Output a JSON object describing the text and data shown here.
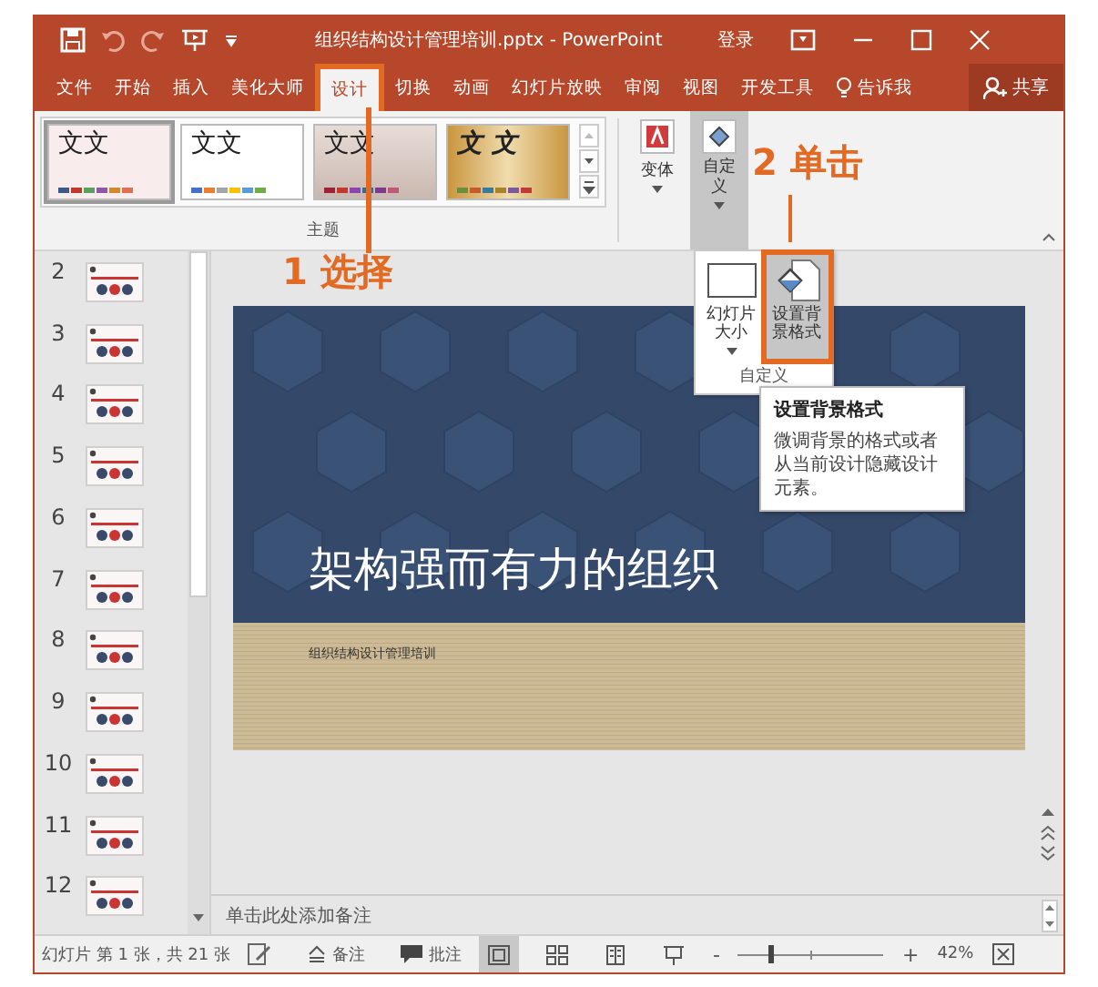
{
  "title_bar": {
    "title": "组织结构设计管理培训.pptx  -  PowerPoint",
    "sign_in": "登录"
  },
  "tabs": [
    {
      "label": "文件",
      "selected": false
    },
    {
      "label": "开始",
      "selected": false
    },
    {
      "label": "插入",
      "selected": false
    },
    {
      "label": "美化大师",
      "selected": false
    },
    {
      "label": "设计",
      "selected": true
    },
    {
      "label": "切换",
      "selected": false
    },
    {
      "label": "动画",
      "selected": false
    },
    {
      "label": "幻灯片放映",
      "selected": false
    },
    {
      "label": "审阅",
      "selected": false
    },
    {
      "label": "视图",
      "selected": false
    },
    {
      "label": "开发工具",
      "selected": false
    }
  ],
  "tell_me": "告诉我",
  "share": "共享",
  "ribbon": {
    "themes": [
      {
        "label": "文文",
        "kind": "pink",
        "selected": true
      },
      {
        "label": "文文",
        "kind": "white",
        "selected": false
      },
      {
        "label": "文文",
        "kind": "gradient",
        "selected": false
      },
      {
        "label": "文 文",
        "kind": "wood",
        "selected": false
      }
    ],
    "theme_group_label": "主题",
    "variants_button": "变体",
    "customize_button": {
      "label": "自定义",
      "expanded": true
    }
  },
  "customize_menu": {
    "buttons": [
      {
        "label": "幻灯片大小",
        "kind": "size",
        "selected": false
      },
      {
        "label": "设置背景格式",
        "kind": "background",
        "selected": true
      }
    ],
    "group_label": "自定义"
  },
  "tooltip": {
    "title": "设置背景格式",
    "body": "微调背景的格式或者从当前设计隐藏设计元素。"
  },
  "annotations": [
    {
      "number": "1",
      "text": "选择"
    },
    {
      "number": "2",
      "text": "单击"
    }
  ],
  "slides": [
    "2",
    "3",
    "4",
    "5",
    "6",
    "7",
    "8",
    "9",
    "10",
    "11",
    "12"
  ],
  "slide": {
    "title": "架构强而有力的组织",
    "subtitle": "组织结构设计管理培训"
  },
  "notes_placeholder": "单击此处添加备注",
  "status_bar": {
    "slide_info": "幻灯片 第 1 张，共 21 张",
    "notes": "备注",
    "comments": "批注",
    "views": [
      {
        "kind": "normal",
        "selected": true
      },
      {
        "kind": "sorter",
        "selected": false
      },
      {
        "kind": "reading",
        "selected": false
      },
      {
        "kind": "slideshow",
        "selected": false
      }
    ],
    "zoom_out": "-",
    "zoom_in": "+",
    "zoom": {
      "level": 0.22
    },
    "zoom_percent": "42%"
  }
}
